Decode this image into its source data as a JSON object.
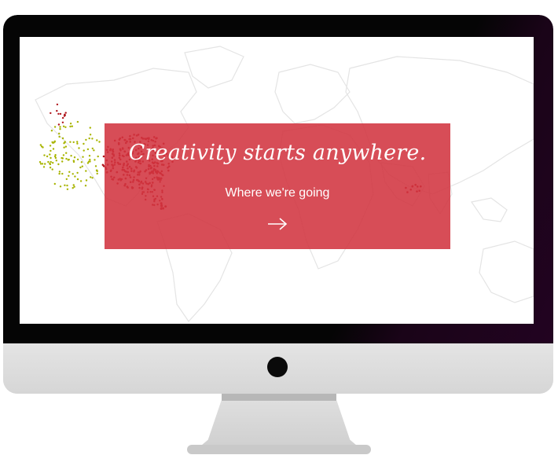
{
  "hero": {
    "title": "Creativity starts anywhere.",
    "link_label": "Where we're going",
    "arrow_icon": "arrow-right-icon"
  },
  "colors": {
    "banner": "#d23440",
    "map_outline": "#e6e6e6",
    "dot_red": "#b0161c",
    "dot_yellow": "#a8b400",
    "bezel": "#050505",
    "chin": "#dcdcdc"
  }
}
